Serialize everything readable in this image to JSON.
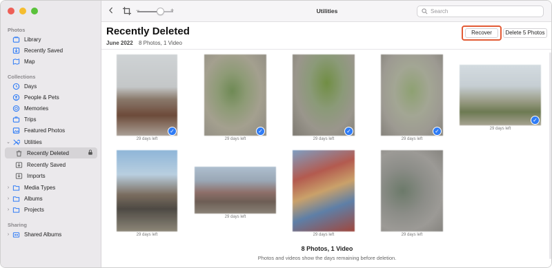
{
  "window": {
    "traffic_colors": [
      "#ee5f57",
      "#f5bd30",
      "#5ac23b"
    ]
  },
  "sidebar": {
    "sections": [
      {
        "label": "Photos",
        "items": [
          {
            "label": "Library",
            "icon": "library-icon"
          },
          {
            "label": "Recently Saved",
            "icon": "recently-saved-icon"
          },
          {
            "label": "Map",
            "icon": "map-icon"
          }
        ]
      },
      {
        "label": "Collections",
        "items": [
          {
            "label": "Days",
            "icon": "clock-icon"
          },
          {
            "label": "People & Pets",
            "icon": "people-icon"
          },
          {
            "label": "Memories",
            "icon": "memories-icon"
          },
          {
            "label": "Trips",
            "icon": "trips-icon"
          },
          {
            "label": "Featured Photos",
            "icon": "featured-photos-icon"
          },
          {
            "label": "Utilities",
            "icon": "utilities-icon",
            "expanded": true
          },
          {
            "label": "Recently Deleted",
            "icon": "trash-icon",
            "active": true,
            "locked": true
          },
          {
            "label": "Recently Saved",
            "icon": "recently-saved-icon"
          },
          {
            "label": "Imports",
            "icon": "imports-icon"
          },
          {
            "label": "Media Types",
            "icon": "folder-icon"
          },
          {
            "label": "Albums",
            "icon": "folder-icon"
          },
          {
            "label": "Projects",
            "icon": "folder-icon"
          }
        ]
      },
      {
        "label": "Sharing",
        "items": [
          {
            "label": "Shared Albums",
            "icon": "shared-albums-icon"
          }
        ]
      }
    ]
  },
  "toolbar": {
    "back_icon": "chevron-left-icon",
    "crop_icon": "crop-icon",
    "zoom_minus": "−",
    "zoom_plus": "+",
    "zoom_level": 0.55,
    "title": "Utilities",
    "search_placeholder": "Search"
  },
  "main": {
    "title": "Recently Deleted",
    "date": "June 2022",
    "summary": "8 Photos, 1 Video",
    "recover_label": "Recover",
    "delete_label": "Delete 5 Photos",
    "accent_color": "#e25a34",
    "selection_color": "#2f7cf6",
    "photos": [
      {
        "days": "29 days left",
        "selected": true
      },
      {
        "days": "29 days left",
        "selected": true
      },
      {
        "days": "29 days left",
        "selected": true
      },
      {
        "days": "29 days left",
        "selected": true
      },
      {
        "days": "29 days left",
        "selected": true
      },
      {
        "days": "29 days left",
        "selected": false
      },
      {
        "days": "29 days left",
        "selected": false
      },
      {
        "days": "29 days left",
        "selected": false
      },
      {
        "days": "29 days left",
        "selected": false
      }
    ],
    "footer_count": "8 Photos, 1 Video",
    "footer_note": "Photos and videos show the days remaining before deletion."
  }
}
